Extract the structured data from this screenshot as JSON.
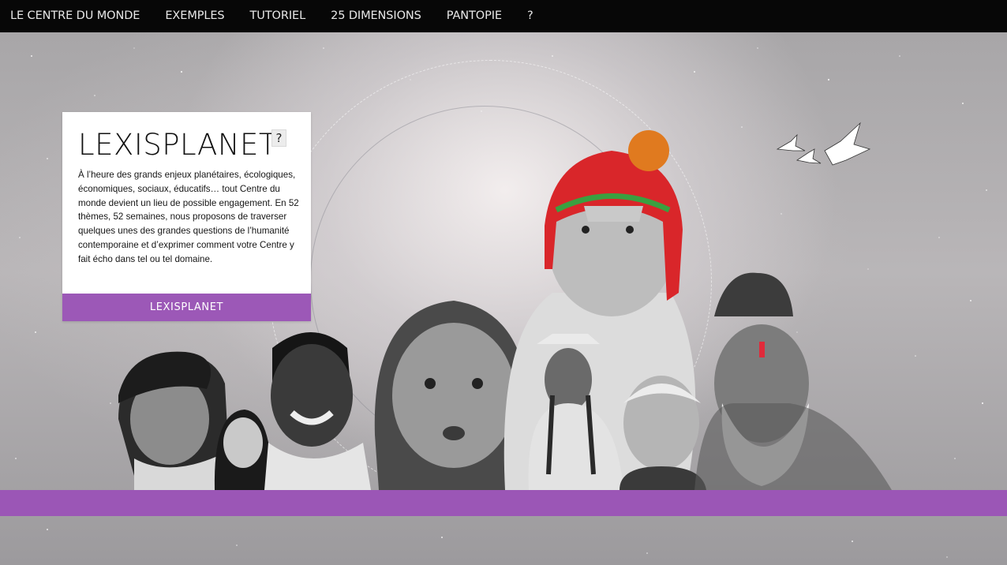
{
  "nav": {
    "items": [
      {
        "label": "LE CENTRE DU MONDE"
      },
      {
        "label": "EXEMPLES"
      },
      {
        "label": "TUTORIEL"
      },
      {
        "label": "25 DIMENSIONS"
      },
      {
        "label": "PANTOPIE"
      },
      {
        "label": "?"
      }
    ]
  },
  "card": {
    "title": "LEXISPLANET",
    "help_label": "?",
    "text": "À l’heure des grands enjeux planétaires, écologiques, économiques, sociaux, éducatifs… tout Centre du monde devient un lieu de possible engagement. En 52 thèmes, 52 semaines, nous proposons de traverser quelques unes des grandes questions de l’humanité contemporaine et d’exprimer comment votre Centre y fait écho dans tel ou tel domaine.",
    "button_label": "LEXISPLANET"
  },
  "colors": {
    "nav_bg": "#070707",
    "accent": "#9c58b7",
    "card_bg": "#ffffff",
    "headdress_red": "#d9262a",
    "headdress_orange": "#e07a1f"
  },
  "illustration": {
    "description_icons": [
      "portraits-collage-icon",
      "paper-cranes-icon",
      "starfield-icon"
    ]
  }
}
